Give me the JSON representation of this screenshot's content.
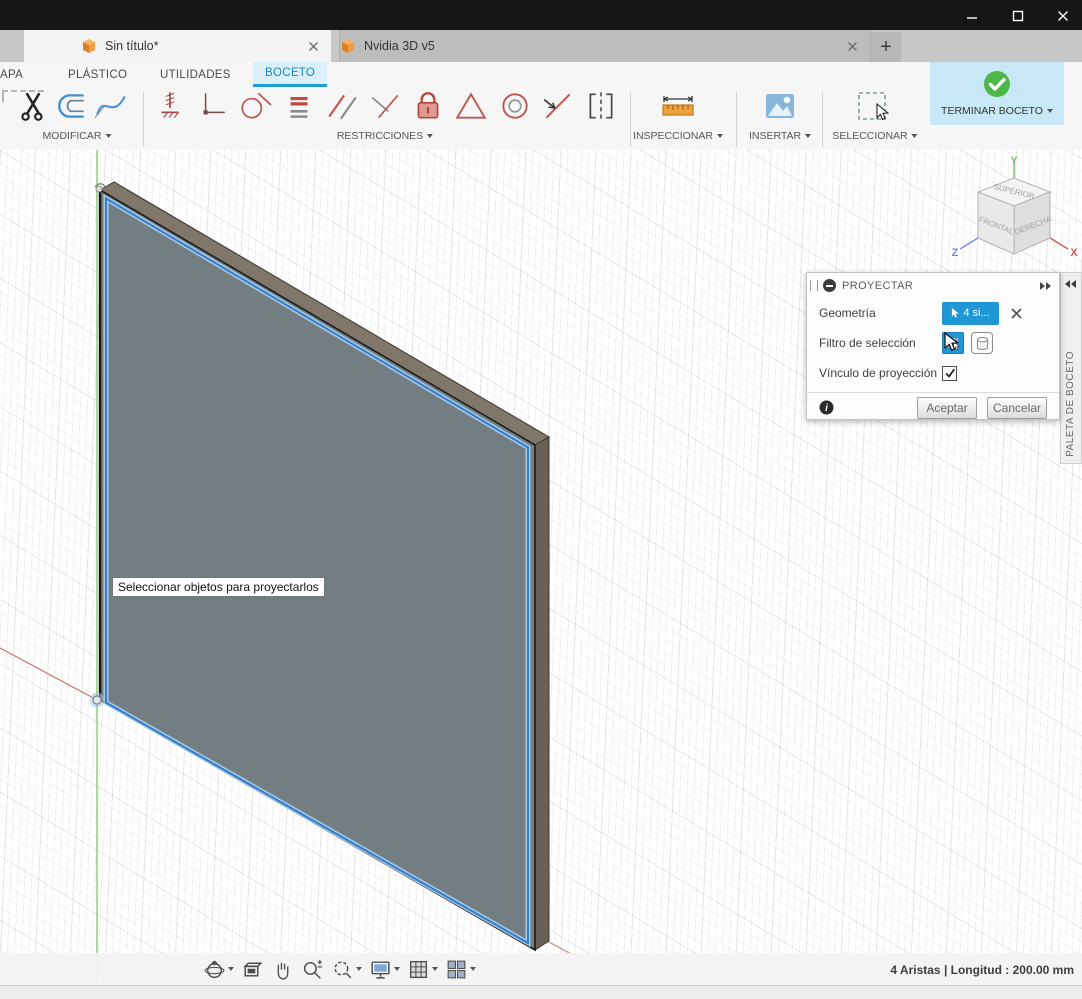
{
  "tabbar": {
    "doc_tab": "Sin título*",
    "remote_tab": "Nvidia 3D v5",
    "new_tab": "+"
  },
  "icons": {
    "help_glyph": "?",
    "info_glyph": "i"
  },
  "ribbon": {
    "tab_chapa": "APA",
    "tab_plastico": "PLÁSTICO",
    "tab_utilidades": "UTILIDADES",
    "tab_boceto": "BOCETO",
    "modify": "MODIFICAR",
    "constraints": "RESTRICCIONES",
    "inspect": "INSPECCIONAR",
    "insert": "INSERTAR",
    "select": "SELECCIONAR",
    "finish": "TERMINAR BOCETO"
  },
  "viewcube": {
    "top": "SUPERIOR",
    "front": "FRONTAL",
    "right": "DERECHA",
    "x": "X",
    "y": "Y",
    "z": "Z"
  },
  "tooltip": "Seleccionar objetos para proyectarlos",
  "dialog": {
    "title": "PROYECTAR",
    "geometry_label": "Geometría",
    "geometry_chip": "4 si...",
    "filter_label": "Filtro de selección",
    "link_label": "Vínculo de proyección",
    "ok": "Aceptar",
    "cancel": "Cancelar"
  },
  "palette": "PALETA DE BOCETO",
  "statusbar": "4 Aristas | Longitud : 200.00 mm",
  "colors": {
    "accent_blue": "#1f97d4",
    "selection_blue": "#2e7ed3",
    "finish_green": "#4db848",
    "axis_x_red": "#cc6a60",
    "axis_y_green": "#74c365",
    "axis_z_blue": "#7b86d8",
    "plate_front": "#727e82",
    "plate_top": "#80776a",
    "plate_side": "#6a6156"
  }
}
